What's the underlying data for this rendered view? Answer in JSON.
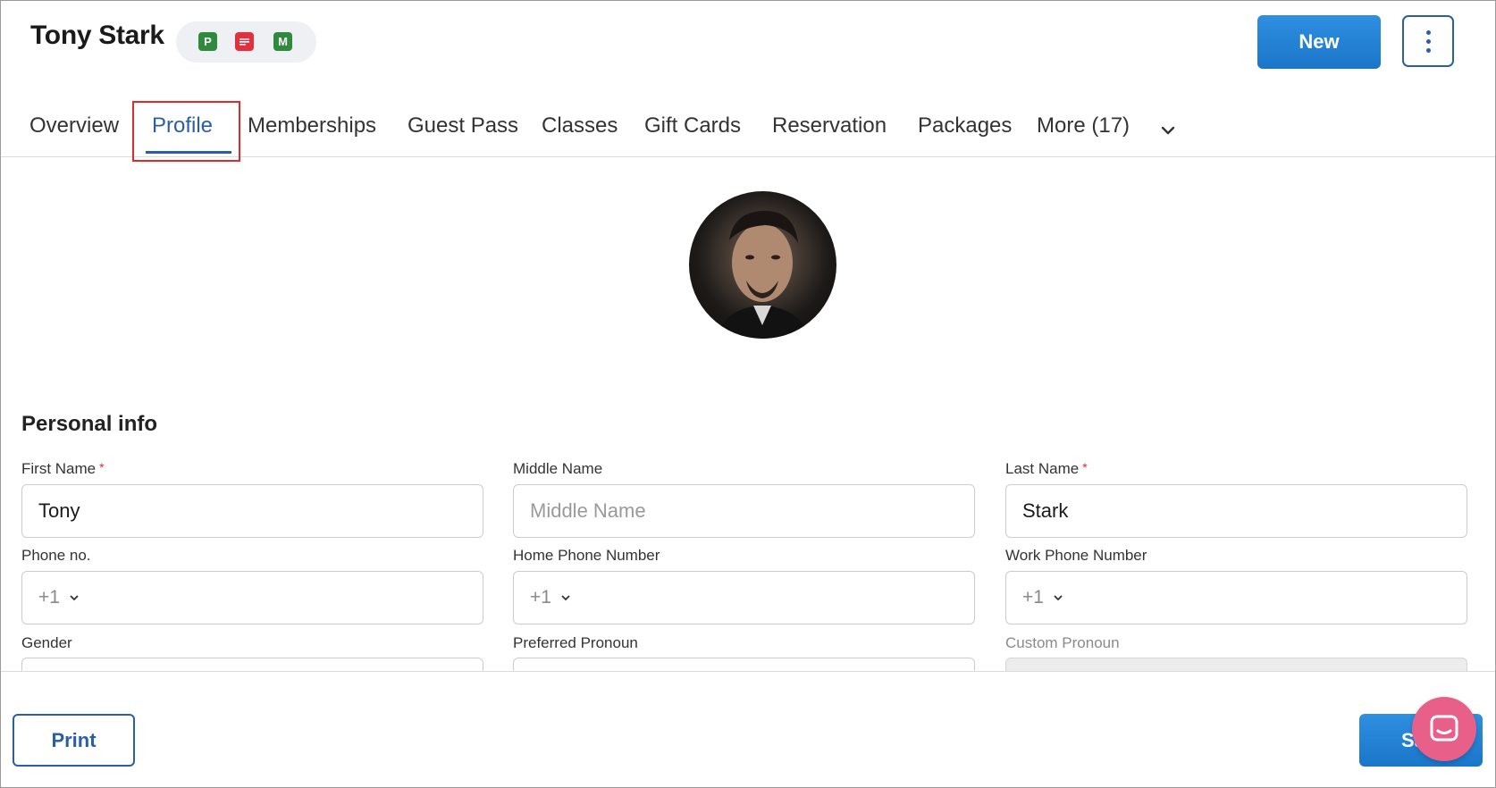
{
  "header": {
    "customer_name": "Tony Stark",
    "badges": [
      {
        "text": "P",
        "icon": "p-badge-icon",
        "color": "#2e8b3e"
      },
      {
        "text": "",
        "icon": "message-badge-icon",
        "color": "#e3303f"
      },
      {
        "text": "M",
        "icon": "m-badge-icon",
        "color": "#2e8b3e"
      }
    ],
    "new_label": "New",
    "menu_icon": "kebab-menu-icon"
  },
  "tabs": [
    {
      "label": "Overview",
      "active": false
    },
    {
      "label": "Profile",
      "active": true
    },
    {
      "label": "Memberships",
      "active": false
    },
    {
      "label": "Guest Pass",
      "active": false
    },
    {
      "label": "Classes",
      "active": false
    },
    {
      "label": "Gift Cards",
      "active": false
    },
    {
      "label": "Reservation",
      "active": false
    },
    {
      "label": "Packages",
      "active": false
    },
    {
      "label": "More (17)",
      "active": false
    }
  ],
  "section": {
    "title": "Personal info"
  },
  "fields": {
    "first_name": {
      "label": "First Name",
      "required": "*",
      "value": "Tony"
    },
    "middle_name": {
      "label": "Middle Name",
      "placeholder": "Middle Name"
    },
    "last_name": {
      "label": "Last Name",
      "required": "*",
      "value": "Stark"
    },
    "phone": {
      "label": "Phone no.",
      "prefix": "+1"
    },
    "home_phone": {
      "label": "Home Phone Number",
      "prefix": "+1"
    },
    "work_phone": {
      "label": "Work Phone Number",
      "prefix": "+1"
    },
    "gender": {
      "label": "Gender"
    },
    "preferred_pronoun": {
      "label": "Preferred Pronoun"
    },
    "custom_pronoun": {
      "label": "Custom Pronoun"
    }
  },
  "footer": {
    "print_label": "Print",
    "save_label_visible": "Sa"
  },
  "colors": {
    "accent": "#2a5fa5",
    "primary_button": "#1e7fd4",
    "highlight": "#e02b2b",
    "chat_widget": "#e8608a"
  }
}
